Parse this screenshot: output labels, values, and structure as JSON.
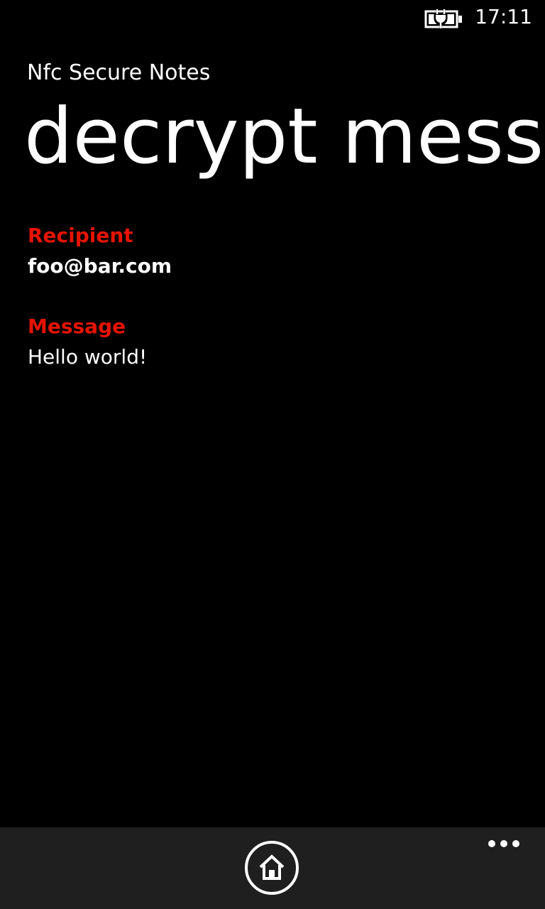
{
  "status_bar": {
    "time": "17:11",
    "battery_icon": "battery-charging-icon"
  },
  "header": {
    "app_name": "Nfc Secure Notes",
    "page_title": "decrypt message"
  },
  "fields": {
    "recipient": {
      "label": "Recipient",
      "value": "foo@bar.com"
    },
    "message": {
      "label": "Message",
      "value": "Hello world!"
    }
  },
  "app_bar": {
    "home_icon": "home-icon",
    "more_icon": "ellipsis-icon"
  },
  "colors": {
    "background": "#000000",
    "accent": "#e51400",
    "app_bar": "#1f1f1f",
    "text": "#ffffff"
  }
}
